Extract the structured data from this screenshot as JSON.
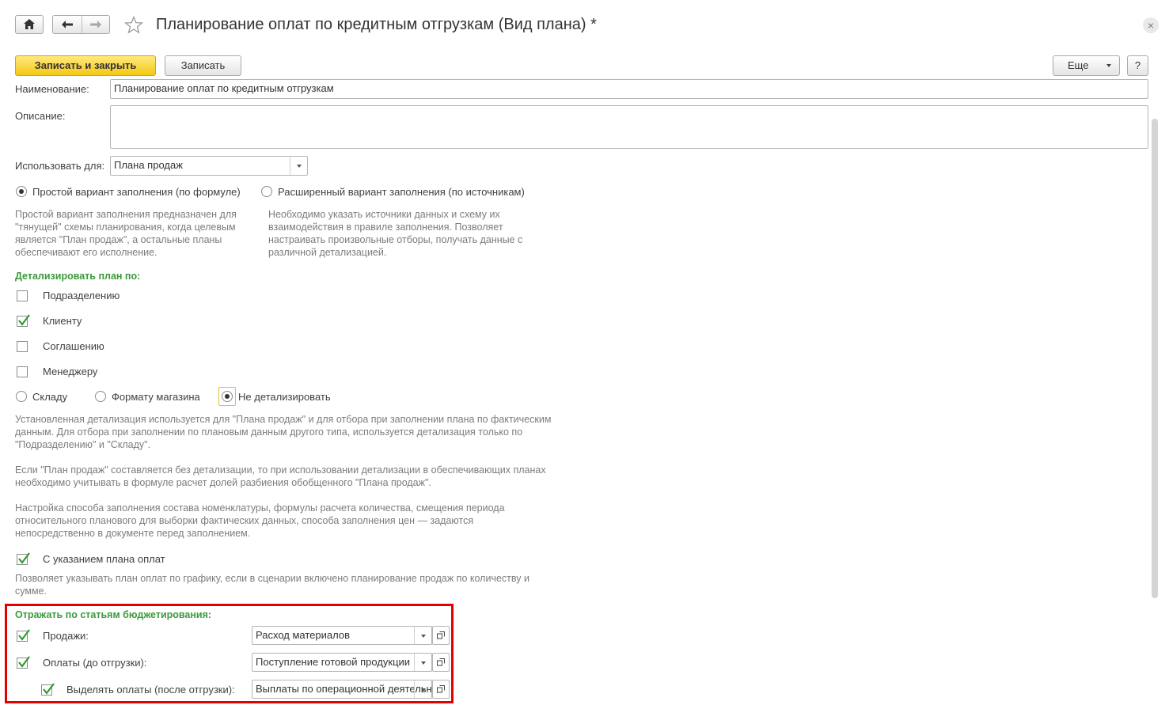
{
  "window": {
    "title": "Планирование оплат по кредитным отгрузкам (Вид плана) *",
    "close": "×"
  },
  "toolbar": {
    "save_close": "Записать и закрыть",
    "save": "Записать",
    "more": "Еще",
    "help": "?"
  },
  "form": {
    "name_label": "Наименование:",
    "name_value": "Планирование оплат по кредитным отгрузкам",
    "description_label": "Описание:",
    "description_value": "",
    "use_for_label": "Использовать для:",
    "use_for_value": "Плана продаж",
    "fill_simple": "Простой вариант заполнения (по формуле)",
    "fill_extended": "Расширенный вариант заполнения (по источникам)",
    "fill_simple_selected": true,
    "hint_simple": [
      "Простой вариант заполнения предназначен для",
      "\"тянущей\" схемы планирования, когда целевым",
      "является \"План продаж\", а остальные планы",
      "обеспечивают его исполнение."
    ],
    "hint_extended": [
      "Необходимо указать источники данных и схему их",
      "взаимодействия в правиле заполнения. Позволяет",
      "настраивать произвольные отборы, получать данные с",
      "различной детализацией."
    ],
    "detail_section": "Детализировать план по:",
    "detail_items": [
      {
        "label": "Подразделению",
        "checked": false
      },
      {
        "label": "Клиенту",
        "checked": true
      },
      {
        "label": "Соглашению",
        "checked": false
      },
      {
        "label": "Менеджеру",
        "checked": false
      }
    ],
    "detail_radios": [
      {
        "label": "Складу",
        "selected": false
      },
      {
        "label": "Формату магазина",
        "selected": false
      },
      {
        "label": "Не детализировать",
        "selected": true
      }
    ],
    "hint_detail": [
      "Установленная детализация используется для \"Плана продаж\" и для отбора при заполнении плана по фактическим",
      "данным. Для отбора при заполнении по плановым данным другого типа, используется детализация только по",
      "\"Подразделению\" и \"Складу\"."
    ],
    "hint_detail2": [
      "Если \"План продаж\" составляется без детализации, то при использовании детализации в обеспечивающих планах",
      "необходимо учитывать в формуле расчет долей разбиения обобщенного \"Плана продаж\"."
    ],
    "hint_detail3": [
      "Настройка способа заполнения состава номенклатуры, формулы расчета количества, смещения периода",
      "относительного планового для выборки фактических данных, способа заполнения цен — задаются",
      "непосредственно в документе перед заполнением."
    ],
    "payment_plan_label": "С указанием плана оплат",
    "payment_plan_checked": true,
    "hint_payment": [
      "Позволяет указывать план оплат по графику, если в сценарии включено планирование продаж по количеству и",
      "сумме."
    ],
    "budget_section": "Отражать по статьям бюджетирования:",
    "budget_rows": [
      {
        "label": "Продажи:",
        "value": "Расход материалов",
        "checked": true
      },
      {
        "label": "Оплаты (до отгрузки):",
        "value": "Поступление готовой продукции",
        "checked": true
      },
      {
        "label": "Выделять оплаты (после отгрузки):",
        "value": "Выплаты по операционной деятельности",
        "checked": true
      }
    ]
  },
  "icons": {
    "home": "home-icon",
    "back": "arrow-left-icon",
    "forward": "arrow-right-icon",
    "favorite": "star-icon",
    "close": "close-icon",
    "dropdown": "chevron-down-icon",
    "open": "open-window-icon",
    "check": "checkmark-icon"
  },
  "colors": {
    "primary_button": "#f5c812",
    "section_header": "#3a9a3a",
    "checkmark": "#2e9b2e",
    "highlight_frame": "#e30000"
  }
}
